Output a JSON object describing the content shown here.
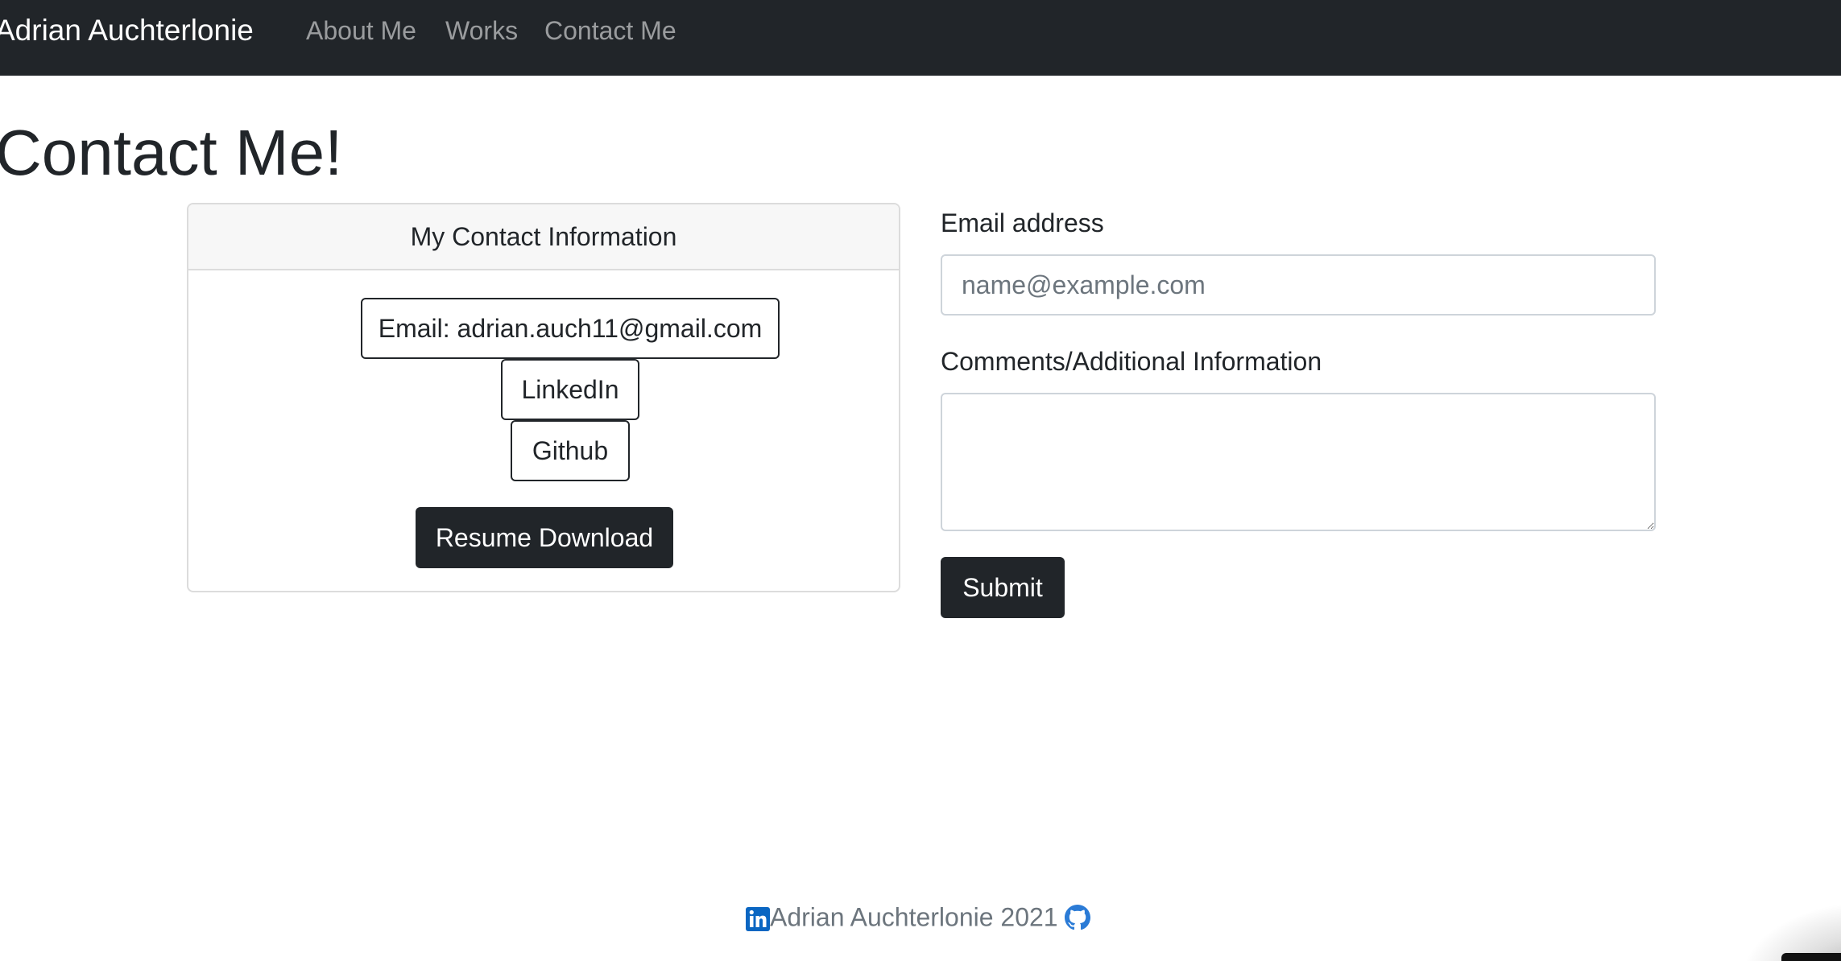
{
  "navbar": {
    "brand": "Adrian Auchterlonie",
    "links": [
      {
        "label": "About Me"
      },
      {
        "label": "Works"
      },
      {
        "label": "Contact Me"
      }
    ]
  },
  "page": {
    "title": "Contact Me!"
  },
  "contact_card": {
    "header": "My Contact Information",
    "email_button": "Email: adrian.auch11@gmail.com",
    "linkedin_button": "LinkedIn",
    "github_button": "Github",
    "resume_button": "Resume Download"
  },
  "form": {
    "email_label": "Email address",
    "email_placeholder": "name@example.com",
    "email_value": "",
    "comments_label": "Comments/Additional Information",
    "comments_value": "",
    "submit_label": "Submit"
  },
  "footer": {
    "text": "Adrian Auchterlonie 2021",
    "icons": [
      "linkedin-icon",
      "github-icon"
    ]
  },
  "colors": {
    "navbar_bg": "#212529",
    "nav_link": "rgba(255,255,255,0.55)",
    "dark_button": "#212529",
    "linkedin_blue": "#0a66c2",
    "github_blue": "#2b7bd6",
    "footer_text": "#6c757d"
  }
}
